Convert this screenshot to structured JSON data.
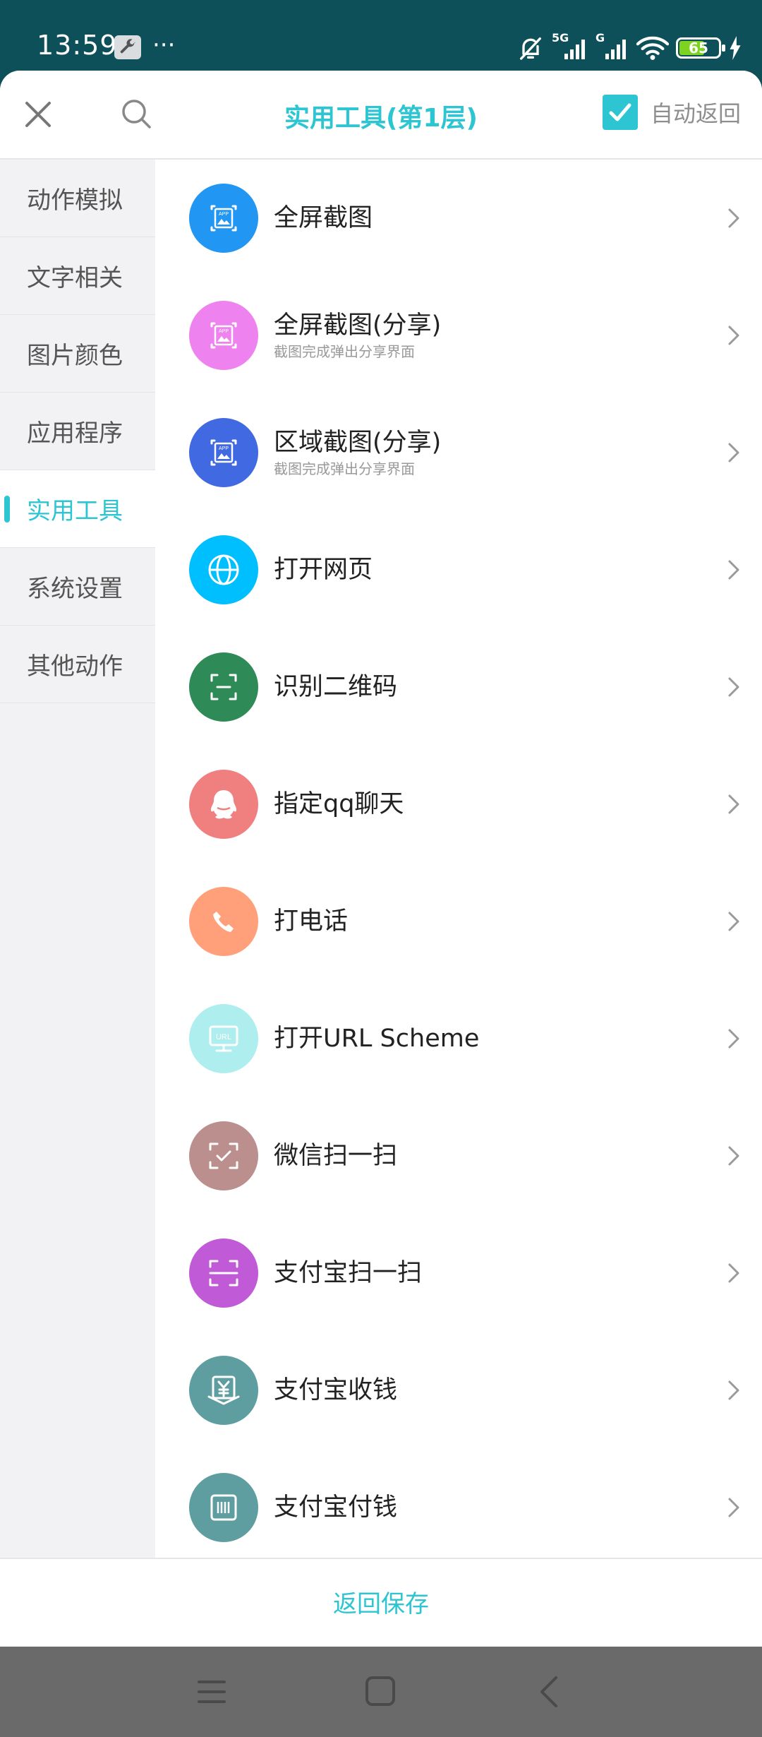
{
  "status_bar": {
    "time": "13:59",
    "network_1": "5G",
    "network_2": "G",
    "battery_level": "65",
    "battery_fraction": 0.65,
    "icons": [
      "wrench-icon",
      "more-dots-icon",
      "bell-muted-icon",
      "signal-icon",
      "signal-icon",
      "wifi-icon",
      "battery-icon",
      "charging-icon"
    ]
  },
  "header": {
    "title": "实用工具(第1层)",
    "auto_return_label": "自动返回",
    "auto_return_checked": true,
    "accent_color": "#2ec5d2"
  },
  "sidebar": {
    "items": [
      {
        "label": "动作模拟",
        "active": false
      },
      {
        "label": "文字相关",
        "active": false
      },
      {
        "label": "图片颜色",
        "active": false
      },
      {
        "label": "应用程序",
        "active": false
      },
      {
        "label": "实用工具",
        "active": true
      },
      {
        "label": "系统设置",
        "active": false
      },
      {
        "label": "其他动作",
        "active": false
      }
    ]
  },
  "list": {
    "items": [
      {
        "title": "全屏截图",
        "subtitle": "",
        "icon": "screenshot-app-icon",
        "color": "#2196f3"
      },
      {
        "title": "全屏截图(分享)",
        "subtitle": "截图完成弹出分享界面",
        "icon": "screenshot-app-icon",
        "color": "#ee82ee"
      },
      {
        "title": "区域截图(分享)",
        "subtitle": "截图完成弹出分享界面",
        "icon": "screenshot-app-icon",
        "color": "#4169e1"
      },
      {
        "title": "打开网页",
        "subtitle": "",
        "icon": "globe-icon",
        "color": "#00bfff"
      },
      {
        "title": "识别二维码",
        "subtitle": "",
        "icon": "scan-frame-icon",
        "color": "#2e8b57"
      },
      {
        "title": "指定qq聊天",
        "subtitle": "",
        "icon": "qq-penguin-icon",
        "color": "#f08080"
      },
      {
        "title": "打电话",
        "subtitle": "",
        "icon": "phone-icon",
        "color": "#ffa07a"
      },
      {
        "title": "打开URL Scheme",
        "subtitle": "",
        "icon": "url-monitor-icon",
        "color": "#aeeeee"
      },
      {
        "title": "微信扫一扫",
        "subtitle": "",
        "icon": "wechat-scan-icon",
        "color": "#bc8f8f"
      },
      {
        "title": "支付宝扫一扫",
        "subtitle": "",
        "icon": "alipay-scan-icon",
        "color": "#c05ad6"
      },
      {
        "title": "支付宝收钱",
        "subtitle": "",
        "icon": "yuan-receive-icon",
        "color": "#5f9ea0"
      },
      {
        "title": "支付宝付钱",
        "subtitle": "",
        "icon": "barcode-pay-icon",
        "color": "#5f9ea0"
      }
    ]
  },
  "footer": {
    "button_label": "返回保存"
  },
  "nav_bar": {
    "icons": [
      "menu-icon",
      "home-square-icon",
      "back-chevron-icon"
    ]
  }
}
